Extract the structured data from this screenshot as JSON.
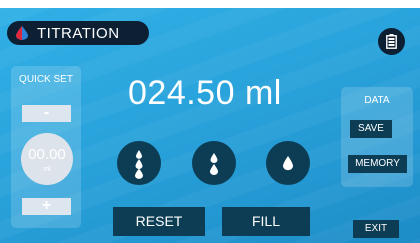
{
  "header": {
    "title": "TITRATION",
    "logo_icon": "drop-logo-icon",
    "battery_icon": "battery-icon"
  },
  "quick_set": {
    "title": "QUICK SET",
    "minus_label": "-",
    "plus_label": "+",
    "value": "00.00",
    "unit": "ml"
  },
  "display": {
    "volume": "024.50 ml"
  },
  "dispense_buttons": [
    {
      "icon": "triple-drop-icon"
    },
    {
      "icon": "double-drop-icon"
    },
    {
      "icon": "single-drop-icon"
    }
  ],
  "actions": {
    "reset_label": "RESET",
    "fill_label": "FILL"
  },
  "data_panel": {
    "title": "DATA",
    "save_label": "SAVE",
    "memory_label": "MEMORY"
  },
  "exit_label": "EXIT",
  "colors": {
    "background": "#2aa4dc",
    "dark_button": "#0c3d55",
    "title_pill": "#0c1f33",
    "logo_drop_red": "#e0283c",
    "logo_drop_blue": "#2e7fd6"
  }
}
